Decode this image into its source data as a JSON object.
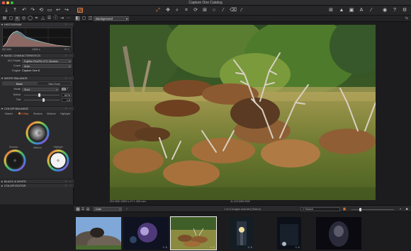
{
  "window": {
    "title": "Capture One Catalog"
  },
  "toolbar": {
    "left_icons": [
      "import-icon",
      "export-icon",
      "undo-icon",
      "redo-icon",
      "reset-icon",
      "trash-icon",
      "back-icon",
      "forward-icon",
      "copy-adjustments-icon"
    ],
    "center_icons": [
      "cursor-icon",
      "pan-icon",
      "loupe-icon",
      "crop-icon",
      "rotate-icon",
      "keystone-icon",
      "spot-icon",
      "brush-icon",
      "eraser-icon",
      "gradient-icon"
    ],
    "right_icons": [
      "grid-icon",
      "exposure-warning-icon",
      "proofing-icon",
      "text-icon",
      "picker-icon",
      "cycle-icon",
      "help-icon",
      "settings-icon"
    ],
    "accent_color": "#e8803a"
  },
  "subbar": {
    "preset_value": "Background",
    "right_text": "⇆"
  },
  "panel": {
    "histogram": {
      "title": "HISTOGRAM",
      "iso": "ISO 800",
      "shutter": "1/500 s",
      "aperture": "f/7.1"
    },
    "basic": {
      "title": "BASIC CHARACTERISTICS",
      "icc_label": "ICC Profile",
      "icc_value": "Fujifilm FinePix X71 Generic",
      "curve_label": "Curve",
      "curve_value": "Auto",
      "engine_label": "Engine",
      "engine_value": "Capture One 8"
    },
    "wb": {
      "title": "WHITE BALANCE",
      "tab_basic": "Basic",
      "tab_skin": "Skin Tone",
      "mode_label": "Mode",
      "mode_value": "Shot",
      "kelvin_label": "Kelvin",
      "kelvin_value": "6276",
      "tint_label": "Tint",
      "tint_value": "1.9",
      "kelvin_level": 0.42,
      "tint_level": 0.55
    },
    "cb": {
      "title": "COLOR BALANCE",
      "tabs": [
        "Master",
        "3-Way",
        "Shadow",
        "Midtone",
        "Highlight"
      ],
      "active_tab": 1,
      "shadow_label": "Shadow",
      "midtone_label": "Midtone",
      "highlight_label": "Highlight"
    },
    "bw": {
      "title": "BLACK & WHITE"
    },
    "ce": {
      "title": "COLOR EDITOR"
    }
  },
  "viewer": {
    "caption_left": "ISO 800    1/500 s    f/7.1    200 mm",
    "caption_center": "JL-DO1089.RAF"
  },
  "browser": {
    "sort_value": "Date",
    "count_text": "1 of 6 images selected (Rated)",
    "search_placeholder": "Search",
    "zoom_level": 0.2,
    "thumbnails": [
      {
        "name": "thumb-bear-rock",
        "selected": false,
        "badge": ""
      },
      {
        "name": "thumb-night-flowers",
        "selected": false,
        "badge": "☆ 1"
      },
      {
        "name": "thumb-elk-herd",
        "selected": true,
        "badge": "☆ 1"
      },
      {
        "name": "thumb-lantern-night",
        "selected": false,
        "badge": "☆ 1"
      },
      {
        "name": "thumb-dark-street",
        "selected": false,
        "badge": "☆ 1"
      },
      {
        "name": "thumb-dark-portrait",
        "selected": false,
        "badge": ""
      }
    ]
  }
}
